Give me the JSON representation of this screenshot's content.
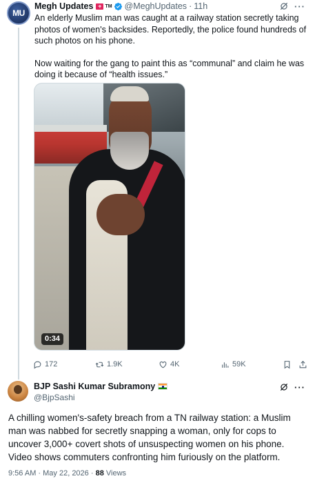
{
  "quoted_post": {
    "avatar_text": "MU",
    "author_name": "Megh Updates",
    "author_badge": "TM",
    "author_handle": "@MeghUpdates",
    "separator": "·",
    "time_ago": "11h",
    "paragraph_1": "An elderly Muslim man was caught at a railway station secretly taking photos of women's backsides. Reportedly, the police found hundreds of such photos on his phone.",
    "paragraph_2": "Now waiting for the gang to paint this as “communal” and claim he was doing it because of “health issues.”",
    "video_duration": "0:34",
    "replies": "172",
    "reposts": "1.9K",
    "likes": "4K",
    "views": "59K"
  },
  "main_post": {
    "author_name": "BJP Sashi Kumar Subramony",
    "author_handle": "@BjpSashi",
    "body": "A chilling women's-safety breach from a TN railway station: a Muslim man was nabbed for secretly snapping a woman, only for cops to uncover 3,000+ covert shots of unsuspecting women on his phone. Video shows commuters confronting him furiously on the platform.",
    "timestamp": "9:56 AM · May 22, 2026 · ",
    "views_count": "88",
    "views_label": " Views"
  },
  "colors": {
    "text_primary": "#0f1419",
    "text_secondary": "#536471",
    "verified_blue": "#1d9bf0",
    "thread_line": "#cfd9de"
  },
  "icons": {
    "verified": "verified-badge-icon",
    "grok": "grok-icon",
    "more": "more-icon",
    "reply": "reply-icon",
    "repost": "repost-icon",
    "like": "like-icon",
    "views": "views-icon",
    "bookmark": "bookmark-icon",
    "share": "share-icon"
  }
}
